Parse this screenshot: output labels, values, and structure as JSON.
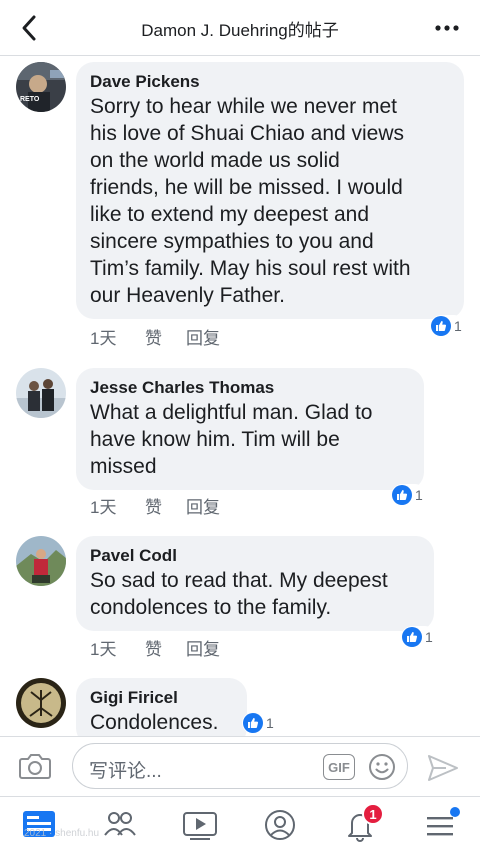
{
  "header": {
    "title": "Damon J. Duehring的帖子"
  },
  "comments": [
    {
      "author": "Dave Pickens",
      "text": "Sorry to hear while we never met his love of Shuai Chiao and views on the world made us solid friends, he will be missed. I would like to extend my deepest and sincere sympathies to you and Tim’s family. May his soul rest with our Heavenly Father.",
      "lines": [
        "Sorry to hear while we never met",
        "his love of Shuai Chiao and views",
        "on the world made us solid",
        "friends, he will be missed. I would",
        "like to extend my deepest and",
        "sincere sympathies to you and",
        "Tim’s family. May his soul rest with",
        "our Heavenly Father."
      ],
      "time": "1天",
      "like_label": "赞",
      "reply_label": "回复",
      "reactions": "1",
      "avatar_text": "RETO"
    },
    {
      "author": "Jesse Charles Thomas",
      "lines": [
        "What a delightful man.  Glad to",
        "have know him.  Tim will be",
        "missed"
      ],
      "time": "1天",
      "like_label": "赞",
      "reply_label": "回复",
      "reactions": "1"
    },
    {
      "author": "Pavel Codl",
      "lines": [
        "So sad to read that. My deepest",
        "condolences to the family."
      ],
      "time": "1天",
      "like_label": "赞",
      "reply_label": "回复",
      "reactions": "1"
    },
    {
      "author": "Gigi Firicel",
      "lines": [
        "Condolences."
      ],
      "reactions": "1"
    }
  ],
  "composer": {
    "placeholder": "写评论...",
    "gif_label": "GIF"
  },
  "nav": {
    "notification_count": "1",
    "watermark": "2021 · shenfu.hu"
  },
  "colors": {
    "accent": "#1877f2",
    "bubble": "#f0f2f5",
    "badge": "#e41e3f"
  }
}
